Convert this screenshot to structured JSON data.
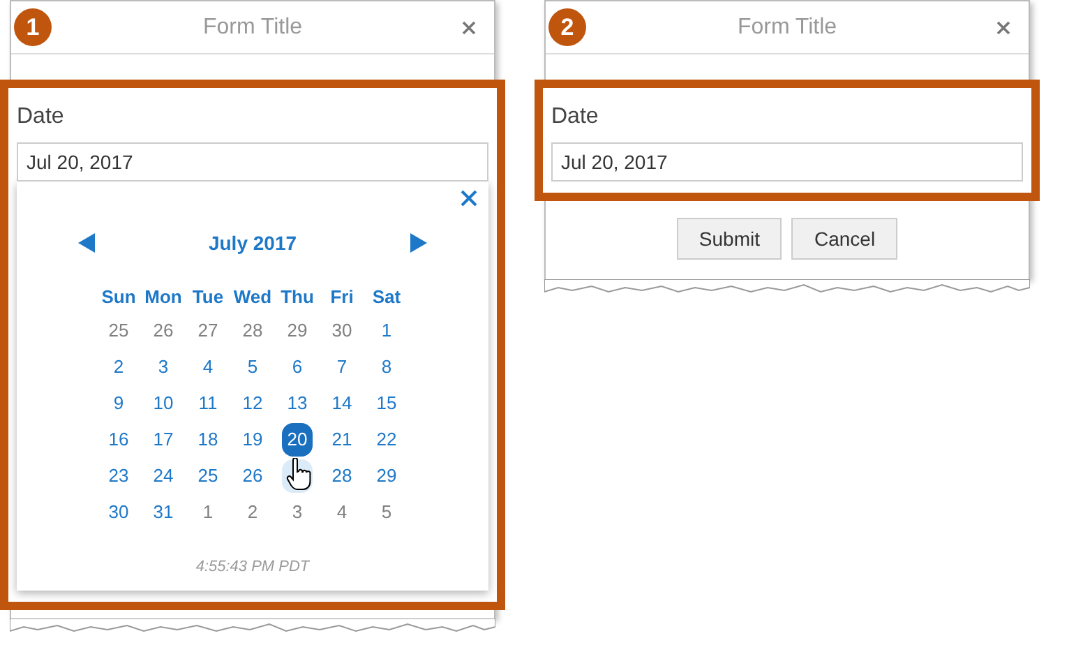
{
  "panels": [
    {
      "badge": "1",
      "title": "Form Title",
      "field": {
        "label": "Date",
        "value": "Jul 20, 2017"
      },
      "calendar": {
        "month": "July 2017",
        "weekdays": [
          "Sun",
          "Mon",
          "Tue",
          "Wed",
          "Thu",
          "Fri",
          "Sat"
        ],
        "weeks": [
          [
            {
              "day": "25",
              "muted": true,
              "selected": false,
              "hovered": false
            },
            {
              "day": "26",
              "muted": true,
              "selected": false,
              "hovered": false
            },
            {
              "day": "27",
              "muted": true,
              "selected": false,
              "hovered": false
            },
            {
              "day": "28",
              "muted": true,
              "selected": false,
              "hovered": false
            },
            {
              "day": "29",
              "muted": true,
              "selected": false,
              "hovered": false
            },
            {
              "day": "30",
              "muted": true,
              "selected": false,
              "hovered": false
            },
            {
              "day": "1",
              "muted": false,
              "selected": false,
              "hovered": false
            }
          ],
          [
            {
              "day": "2",
              "muted": false,
              "selected": false,
              "hovered": false
            },
            {
              "day": "3",
              "muted": false,
              "selected": false,
              "hovered": false
            },
            {
              "day": "4",
              "muted": false,
              "selected": false,
              "hovered": false
            },
            {
              "day": "5",
              "muted": false,
              "selected": false,
              "hovered": false
            },
            {
              "day": "6",
              "muted": false,
              "selected": false,
              "hovered": false
            },
            {
              "day": "7",
              "muted": false,
              "selected": false,
              "hovered": false
            },
            {
              "day": "8",
              "muted": false,
              "selected": false,
              "hovered": false
            }
          ],
          [
            {
              "day": "9",
              "muted": false,
              "selected": false,
              "hovered": false
            },
            {
              "day": "10",
              "muted": false,
              "selected": false,
              "hovered": false
            },
            {
              "day": "11",
              "muted": false,
              "selected": false,
              "hovered": false
            },
            {
              "day": "12",
              "muted": false,
              "selected": false,
              "hovered": false
            },
            {
              "day": "13",
              "muted": false,
              "selected": false,
              "hovered": false
            },
            {
              "day": "14",
              "muted": false,
              "selected": false,
              "hovered": false
            },
            {
              "day": "15",
              "muted": false,
              "selected": false,
              "hovered": false
            }
          ],
          [
            {
              "day": "16",
              "muted": false,
              "selected": false,
              "hovered": false
            },
            {
              "day": "17",
              "muted": false,
              "selected": false,
              "hovered": false
            },
            {
              "day": "18",
              "muted": false,
              "selected": false,
              "hovered": false
            },
            {
              "day": "19",
              "muted": false,
              "selected": false,
              "hovered": false
            },
            {
              "day": "20",
              "muted": false,
              "selected": true,
              "hovered": false
            },
            {
              "day": "21",
              "muted": false,
              "selected": false,
              "hovered": false
            },
            {
              "day": "22",
              "muted": false,
              "selected": false,
              "hovered": false
            }
          ],
          [
            {
              "day": "23",
              "muted": false,
              "selected": false,
              "hovered": false
            },
            {
              "day": "24",
              "muted": false,
              "selected": false,
              "hovered": false
            },
            {
              "day": "25",
              "muted": false,
              "selected": false,
              "hovered": false
            },
            {
              "day": "26",
              "muted": false,
              "selected": false,
              "hovered": false
            },
            {
              "muted": false,
              "selected": false,
              "hovered": true
            },
            {
              "day": "28",
              "muted": false,
              "selected": false,
              "hovered": false
            },
            {
              "day": "29",
              "muted": false,
              "selected": false,
              "hovered": false
            }
          ],
          [
            {
              "day": "30",
              "muted": false,
              "selected": false,
              "hovered": false
            },
            {
              "day": "31",
              "muted": false,
              "selected": false,
              "hovered": false
            },
            {
              "day": "1",
              "muted": true,
              "selected": false,
              "hovered": false
            },
            {
              "day": "2",
              "muted": true,
              "selected": false,
              "hovered": false
            },
            {
              "day": "3",
              "muted": true,
              "selected": false,
              "hovered": false
            },
            {
              "day": "4",
              "muted": true,
              "selected": false,
              "hovered": false
            },
            {
              "day": "5",
              "muted": true,
              "selected": false,
              "hovered": false
            }
          ]
        ],
        "time": "4:55:43 PM PDT"
      }
    },
    {
      "badge": "2",
      "title": "Form Title",
      "field": {
        "label": "Date",
        "value": "Jul 20, 2017"
      },
      "buttons": [
        "Submit",
        "Cancel"
      ]
    }
  ]
}
